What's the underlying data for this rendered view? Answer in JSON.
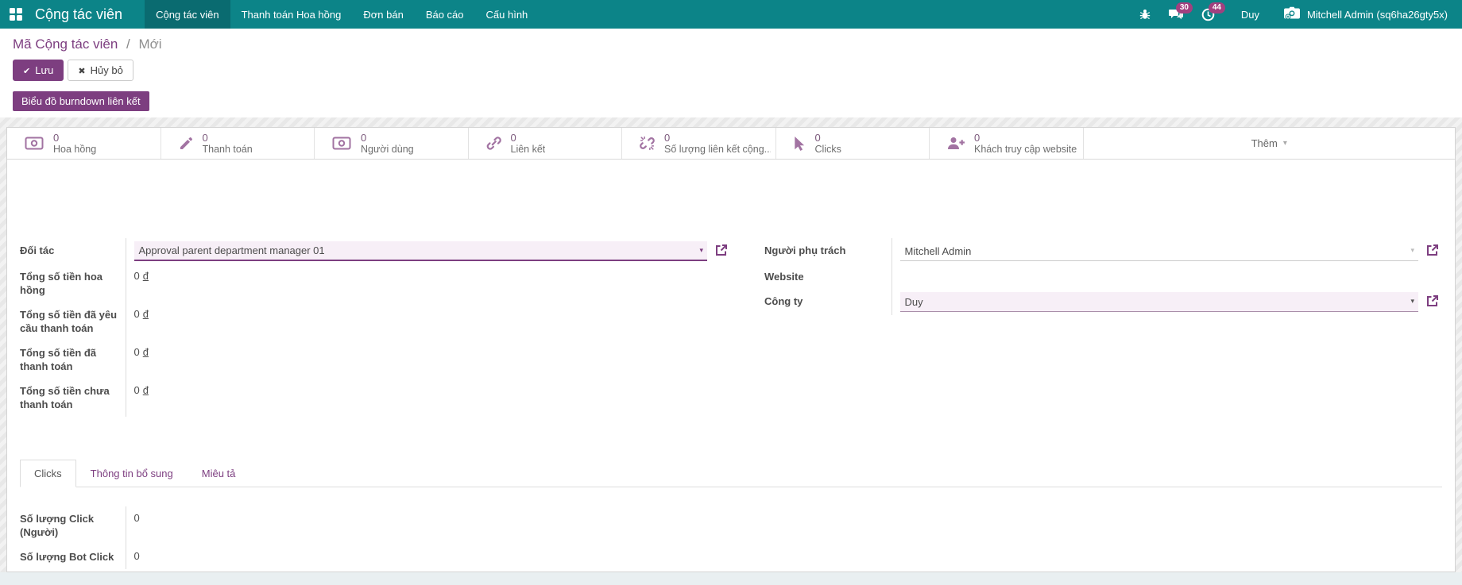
{
  "nav": {
    "app_name": "Cộng tác viên",
    "menu": [
      "Cộng tác viên",
      "Thanh toán Hoa hồng",
      "Đơn bán",
      "Báo cáo",
      "Cấu hình"
    ],
    "messages_badge": "30",
    "activities_badge": "44",
    "company": "Duy",
    "user": "Mitchell Admin (sq6ha26gty5x)"
  },
  "breadcrumb": {
    "parent": "Mã Cộng tác viên",
    "separator": "/",
    "current": "Mới"
  },
  "actions": {
    "save_icon": "✔",
    "save": "Lưu",
    "discard_icon": "✖",
    "discard": "Hủy bỏ",
    "burndown": "Biểu đồ burndown liên kết"
  },
  "stat_buttons": [
    {
      "icon": "money-bill-icon",
      "value": "0",
      "label": "Hoa hồng"
    },
    {
      "icon": "pencil-icon",
      "value": "0",
      "label": "Thanh toán"
    },
    {
      "icon": "money-bill-icon",
      "value": "0",
      "label": "Người dùng"
    },
    {
      "icon": "link-icon",
      "value": "0",
      "label": "Liên kết"
    },
    {
      "icon": "unlink-icon",
      "value": "0",
      "label": "Số lượng liên kết cộng..."
    },
    {
      "icon": "mouse-pointer-icon",
      "value": "0",
      "label": "Clicks"
    },
    {
      "icon": "user-plus-icon",
      "value": "0",
      "label": "Khách truy cập website"
    }
  ],
  "more_button": {
    "label": "Thêm",
    "caret": "▾"
  },
  "form": {
    "left_fields": [
      {
        "label": "Đối tác",
        "value": "Approval parent department manager 01"
      },
      {
        "label": "Tổng số tiền hoa hồng",
        "amount": "0",
        "currency": "đ"
      },
      {
        "label": "Tổng số tiền đã yêu cầu thanh toán",
        "amount": "0",
        "currency": "đ"
      },
      {
        "label": "Tổng số tiền đã thanh toán",
        "amount": "0",
        "currency": "đ"
      },
      {
        "label": "Tổng số tiền chưa thanh toán",
        "amount": "0",
        "currency": "đ"
      }
    ],
    "right_fields": [
      {
        "label": "Người phụ trách",
        "value": "Mitchell Admin"
      },
      {
        "label": "Website",
        "value": ""
      },
      {
        "label": "Công ty",
        "value": "Duy"
      }
    ]
  },
  "tabs": [
    {
      "label": "Clicks"
    },
    {
      "label": "Thông tin bổ sung"
    },
    {
      "label": "Miêu tả"
    }
  ],
  "click_fields": [
    {
      "label": "Số lượng Click (Người)",
      "value": "0"
    },
    {
      "label": "Số lượng Bot Click",
      "value": "0"
    }
  ],
  "colors": {
    "navbar": "#0c8488",
    "navbar_active": "#0a6b70",
    "accent_purple": "#7d3e80",
    "badge_magenta": "#a2407f",
    "field_highlight": "#f7eff7",
    "stat_icon_purple": "#a273a2"
  }
}
